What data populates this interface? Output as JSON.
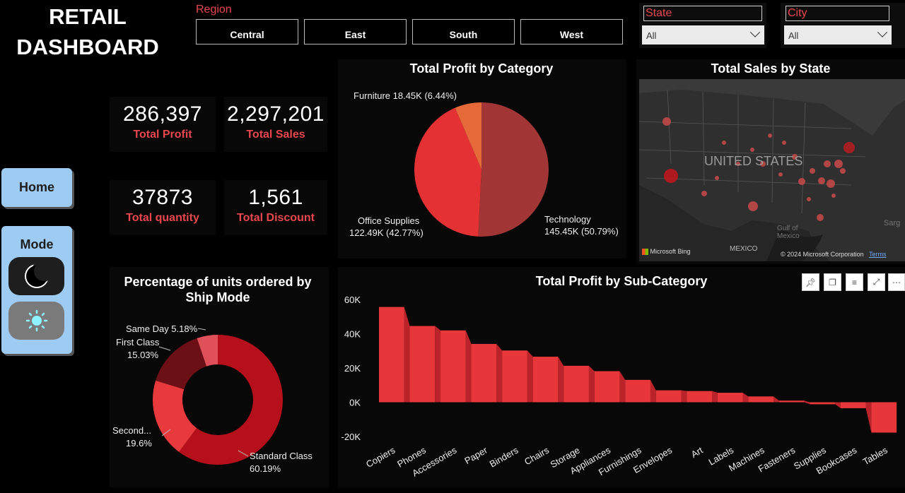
{
  "header": {
    "title_line1": "RETAIL",
    "title_line2": "DASHBOARD"
  },
  "region": {
    "label": "Region",
    "options": [
      "Central",
      "East",
      "South",
      "West"
    ]
  },
  "state": {
    "label": "State",
    "value": "All"
  },
  "city": {
    "label": "City",
    "value": "All"
  },
  "kpis": [
    {
      "value": "286,397",
      "label": "Total Profit"
    },
    {
      "value": "2,297,201",
      "label": "Total Sales"
    },
    {
      "value": "37873",
      "label": "Total quantity"
    },
    {
      "value": "1,561",
      "label": "Total Discount"
    }
  ],
  "nav": {
    "home_label": "Home",
    "mode_label": "Mode"
  },
  "pie": {
    "title": "Total Profit by Category",
    "furniture_label": "Furniture 18.45K (6.44%)",
    "office_label_1": "Office Supplies",
    "office_label_2": "122.49K (42.77%)",
    "tech_label_1": "Technology",
    "tech_label_2": "145.45K (50.79%)"
  },
  "donut": {
    "title_1": "Percentage of units ordered by",
    "title_2": "Ship Mode",
    "same_day_label": "Same Day 5.18%",
    "first_class_label_1": "First Class",
    "first_class_label_2": "15.03%",
    "second_label_1": "Second...",
    "second_label_2": "19.6%",
    "standard_label_1": "Standard Class",
    "standard_label_2": "60.19%"
  },
  "map": {
    "title": "Total Sales by State",
    "country_label": "UNITED STATES",
    "mexico_label": "MEXICO",
    "gulf_label_1": "Gulf of",
    "gulf_label_2": "Mexico",
    "sarg_label": "Sarg",
    "bing_label": "Microsoft Bing",
    "copyright": "© 2024 Microsoft Corporation",
    "terms": "Terms"
  },
  "bar": {
    "title": "Total Profit by Sub-Category"
  },
  "colors": {
    "accent": "#e8474e",
    "technology": "#a23535",
    "office": "#e43234",
    "furniture": "#e6693a",
    "standard": "#b5101b",
    "second": "#e8393d",
    "first": "#6c0f16",
    "same_day": "#e0505a",
    "bar": "#e8373b",
    "bar_side": "#b92329"
  },
  "chart_data": [
    {
      "type": "pie",
      "title": "Total Profit by Category",
      "categories": [
        "Technology",
        "Office Supplies",
        "Furniture"
      ],
      "values": [
        145.45,
        122.49,
        18.45
      ],
      "percent": [
        50.79,
        42.77,
        6.44
      ]
    },
    {
      "type": "pie",
      "title": "Percentage of units ordered by Ship Mode",
      "categories": [
        "Standard Class",
        "Second...",
        "First Class",
        "Same Day"
      ],
      "values": [
        60.19,
        19.6,
        15.03,
        5.18
      ]
    },
    {
      "type": "bar",
      "title": "Total Profit by Sub-Category",
      "categories": [
        "Copiers",
        "Phones",
        "Accessories",
        "Paper",
        "Binders",
        "Chairs",
        "Storage",
        "Appliances",
        "Furnishings",
        "Envelopes",
        "Art",
        "Labels",
        "Machines",
        "Fasteners",
        "Supplies",
        "Bookcases",
        "Tables"
      ],
      "values": [
        55618,
        44516,
        41937,
        34054,
        30222,
        26590,
        21279,
        18138,
        13059,
        6964,
        6528,
        5546,
        3385,
        950,
        -1189,
        -3473,
        -17725
      ],
      "ylim": [
        -20000,
        60000
      ],
      "yticks": [
        "60K",
        "40K",
        "20K",
        "0K",
        "-20K"
      ]
    }
  ]
}
